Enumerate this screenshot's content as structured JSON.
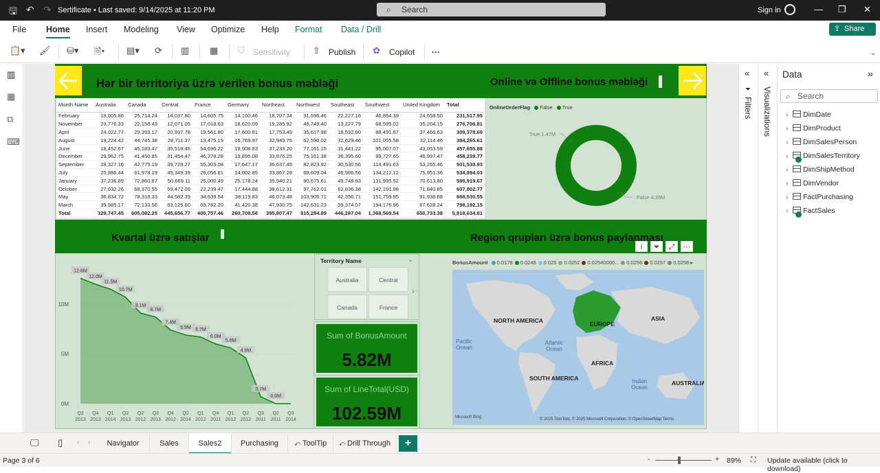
{
  "titlebar": {
    "doc_title": "Sertificate • Last saved: 9/14/2025 at 11:20 PM",
    "search_placeholder": "Search",
    "signin": "Sign in"
  },
  "menu": {
    "items": [
      "File",
      "Home",
      "Insert",
      "Modeling",
      "View",
      "Optimize",
      "Help",
      "Format",
      "Data / Drill"
    ],
    "active": "Home",
    "share": "Share"
  },
  "ribbon": {
    "sensitivity": "Sensitivity",
    "publish": "Publish",
    "copilot": "Copilot",
    "more": "···"
  },
  "report": {
    "title_top_left": "Hər bir territoriya üzrə verilen bonus məbləği",
    "title_top_right": "Online və Offline bonus məbləği",
    "title_bottom_left": "Kvartal üzrə satışlar",
    "title_bottom_right": "Region qrupları üzrə bonus paylanması",
    "matrix": {
      "headers": [
        "Month Name",
        "Australia",
        "Canada",
        "Central",
        "France",
        "Germany",
        "Northeast",
        "Northwest",
        "Southeast",
        "Southwest",
        "United Kingdom",
        "Total"
      ],
      "rows": [
        [
          "February",
          "19,005.86",
          "25,714.24",
          "14,037.80",
          "14,605.75",
          "14,100.46",
          "18,707.34",
          "31,596.46",
          "22,227.16",
          "46,864.39",
          "24,658.50",
          "231,517.95"
        ],
        [
          "November",
          "23,776.33",
          "22,158.43",
          "12,071.05",
          "17,018.63",
          "18,620.09",
          "19,285.92",
          "46,749.40",
          "13,227.79",
          "68,595.02",
          "35,204.15",
          "276,706.81"
        ],
        [
          "April",
          "24,022.77",
          "29,393.17",
          "20,937.78",
          "19,561.80",
          "17,600.81",
          "17,753.49",
          "35,617.98",
          "18,532.60",
          "88,491.67",
          "37,466.63",
          "309,378.69"
        ],
        [
          "August",
          "19,224.42",
          "44,745.38",
          "28,711.37",
          "13,475.19",
          "16,769.97",
          "32,949.76",
          "62,590.02",
          "32,629.46",
          "101,055.58",
          "32,114.46",
          "384,265.61"
        ],
        [
          "June",
          "18,452.67",
          "45,183.47",
          "35,518.45",
          "54,696.22",
          "19,908.83",
          "37,233.20",
          "77,161.15",
          "31,441.22",
          "95,007.07",
          "43,053.59",
          "457,655.88"
        ],
        [
          "December",
          "29,962.75",
          "41,450.85",
          "31,454.47",
          "46,378.28",
          "19,895.08",
          "33,876.25",
          "75,161.38",
          "36,395.60",
          "99,727.65",
          "46,997.47",
          "458,239.77"
        ],
        [
          "September",
          "28,327.16",
          "42,775.19",
          "39,729.27",
          "55,303.08",
          "17,647.17",
          "36,637.49",
          "82,823.92",
          "30,530.56",
          "114,491.63",
          "53,265.46",
          "501,530.93"
        ],
        [
          "July",
          "25,886.44",
          "61,978.19",
          "45,349.39",
          "28,056.81",
          "14,002.85",
          "33,867.28",
          "68,609.04",
          "46,986.56",
          "134,212.12",
          "75,951.36",
          "534,894.03"
        ],
        [
          "January",
          "37,236.89",
          "72,860.87",
          "50,669.11",
          "25,000.49",
          "25,178.24",
          "35,940.21",
          "90,675.61",
          "49,748.93",
          "131,995.52",
          "70,613.80",
          "589,919.67"
        ],
        [
          "October",
          "27,032.26",
          "68,370.55",
          "59,472.09",
          "22,239.47",
          "17,444.88",
          "38,612.31",
          "97,762.01",
          "62,836.38",
          "142,191.98",
          "71,840.85",
          "607,802.77"
        ],
        [
          "May",
          "36,834.72",
          "78,318.33",
          "44,582.39",
          "34,639.54",
          "38,119.83",
          "46,073.48",
          "103,906.71",
          "42,356.71",
          "151,759.95",
          "91,938.88",
          "668,530.55"
        ],
        [
          "March",
          "39,985.17",
          "72,133.56",
          "63,129.60",
          "69,782.20",
          "41,420.38",
          "47,930.75",
          "142,631.23",
          "59,374.07",
          "194,176.96",
          "67,628.24",
          "798,192.15"
        ]
      ],
      "total": [
        "Total",
        "329,747.45",
        "605,082.25",
        "445,656.77",
        "400,757.46",
        "260,708.58",
        "395,807.47",
        "915,284.89",
        "446,287.04",
        "1,368,569.54",
        "650,733.38",
        "5,818,634.81"
      ]
    },
    "donut": {
      "legend_title": "OnlineOrderFlag",
      "legend": [
        "False",
        "True"
      ],
      "label_true": "True 1.47M",
      "label_false": "False 4.35M",
      "color": "#0f7f0f"
    },
    "slicer": {
      "title": "Territory Name",
      "options": [
        "Australia",
        "Central",
        "Canada",
        "France"
      ]
    },
    "cards": [
      {
        "label": "Sum of BonusAmount",
        "value": "5.82M"
      },
      {
        "label": "Sum of LineTotal(USD)",
        "value": "102.59M"
      }
    ],
    "map": {
      "legend_title": "BonusAmount",
      "legend": [
        {
          "label": "0.0178",
          "color": "#5e9aa8"
        },
        {
          "label": "0.0248",
          "color": "#0f7f0f"
        },
        {
          "label": "0.025",
          "color": "#7fc6e8"
        },
        {
          "label": "0.0252",
          "color": "#8fa88f"
        },
        {
          "label": "0.02540000...",
          "color": "#8b2020"
        },
        {
          "label": "0.0256",
          "color": "#8f8f8f"
        },
        {
          "label": "0.0257",
          "color": "#8b1a1a"
        },
        {
          "label": "0.0258",
          "color": "#7f7f7f"
        }
      ],
      "labels": [
        "NORTH AMERICA",
        "EUROPE",
        "ASIA",
        "AFRICA",
        "SOUTH AMERICA",
        "AUSTRALIA"
      ],
      "oceans": [
        "Pacific Ocean",
        "Atlantic Ocean",
        "Indian Ocean"
      ],
      "attribution": "© 2025 TomTom, © 2025 Microsoft Corporation, © OpenStreetMap  Terms",
      "brand": "Microsoft Bing"
    }
  },
  "chart_data": {
    "type": "area",
    "title": "Kvartal üzrə satışlar",
    "categories": [
      "Q3 2013",
      "Q4 2013",
      "Q1 2014",
      "Q2 2013",
      "Q2 2012",
      "Q3 2012",
      "Q4 2012",
      "Q1 2012",
      "Q2 2011",
      "Q1 2011",
      "Q4 2011",
      "Q1 2012",
      "Q3 2011",
      "Q2 2011",
      "Q3 2014"
    ],
    "tick_quarters": [
      "Q3",
      "Q4",
      "Q1",
      "Q2",
      "Q2",
      "Q3",
      "Q4",
      "Q2",
      "Q1",
      "Q4",
      "Q1",
      "Q2",
      "Q3",
      "Q2",
      "Q3"
    ],
    "tick_years": [
      "2013",
      "2013",
      "2014",
      "2013",
      "2012",
      "2013",
      "2012",
      "2014",
      "2012",
      "2011",
      "2012",
      "2012",
      "2011",
      "2011",
      "2014"
    ],
    "data_labels": [
      "12.6M",
      "12.0M",
      "11.5M",
      "10.7M",
      "9.1M",
      "8.7M",
      "7.4M",
      "6.9M",
      "6.7M",
      "6.0M",
      "5.6M",
      "4.6M",
      "0.7M",
      "0.0M"
    ],
    "values": [
      12.6,
      12.0,
      11.5,
      10.7,
      9.1,
      8.7,
      7.4,
      6.9,
      6.7,
      6.0,
      5.6,
      4.6,
      0.7,
      0.0,
      0.0
    ],
    "y_ticks": [
      "10M",
      "5M",
      "0M"
    ],
    "ylim": [
      0,
      14
    ],
    "color": "#0f7f0f"
  },
  "filters_label": "Filters",
  "visualizations_label": "Visualizations",
  "data_pane": {
    "title": "Data",
    "search_placeholder": "Search",
    "tables": [
      "DimDate",
      "DimProduct",
      "DimSalesPerson",
      "DimSalesTerritory",
      "DimShipMethod",
      "DimVendor",
      "FactPurchasing",
      "FactSales"
    ]
  },
  "tabs": {
    "items": [
      "Navigator",
      "Sales",
      "Sales2",
      "Purchasing",
      "ToolTip",
      "Drill Through"
    ],
    "active": "Sales2"
  },
  "status": {
    "page": "Page 3 of 6",
    "zoom": "89%",
    "update": "Update available (click to download)"
  }
}
